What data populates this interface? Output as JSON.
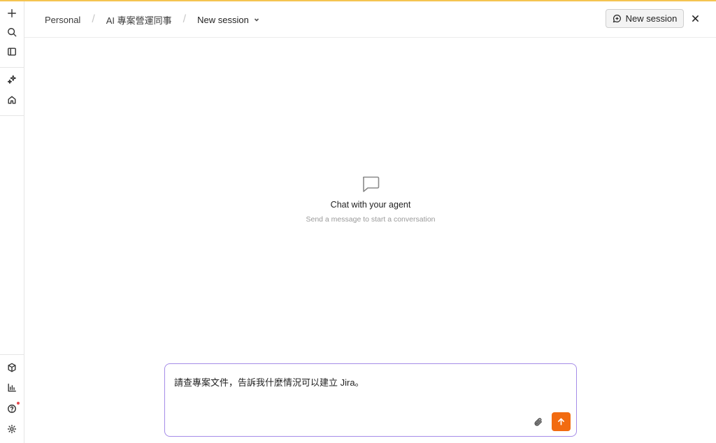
{
  "breadcrumb": {
    "workspace": "Personal",
    "agent": "AI 專案營運同事",
    "session": "New session"
  },
  "header": {
    "new_session_label": "New session"
  },
  "empty_state": {
    "title": "Chat with your agent",
    "subtitle": "Send a message to start a conversation"
  },
  "composer": {
    "text": "請查專案文件，告訴我什麼情況可以建立 Jira。"
  },
  "colors": {
    "accent_top": "#f5c451",
    "send_button": "#f26b10",
    "composer_border": "#a58ce8",
    "notification_dot": "#e5484d"
  }
}
